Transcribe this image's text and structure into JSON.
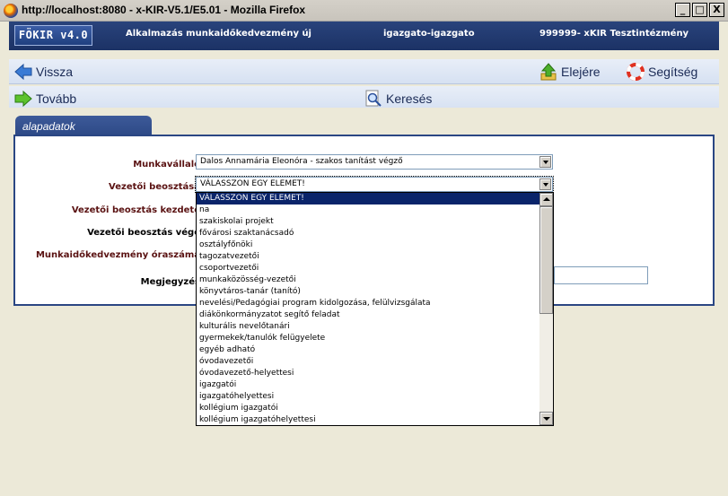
{
  "window": {
    "title": "http://localhost:8080 - x-KIR-V5.1/E5.01 - Mozilla Firefox",
    "buttons": {
      "minimize": "_",
      "restore": "□",
      "close": "X"
    }
  },
  "header": {
    "logo": "FÖKIR v4.0",
    "page_title": "Alkalmazás munkaidőkedvezmény új",
    "user": "igazgato-igazgato",
    "institution": "999999- xKIR Tesztintézmény"
  },
  "toolbar1": {
    "back": "Vissza",
    "home": "Elejére",
    "help": "Segítség"
  },
  "toolbar2": {
    "next": "Tovább",
    "search": "Keresés"
  },
  "tab": {
    "label": "alapadatok"
  },
  "form": {
    "employee_label": "Munkavállaló:",
    "employee_value": "Dalos Annamária Eleonóra - szakos tanítást végző",
    "position_label": "Vezetői beosztása:",
    "position_value": "VÁLASSZON EGY ELEMET!",
    "start_label": "Vezetői beosztás kezdete:",
    "end_label": "Vezetői beosztás vége:",
    "hours_label": "Munkaidőkedvezmény óraszáma:",
    "notes_label": "Megjegyzés:"
  },
  "dropdown": {
    "selected_index": 0,
    "options": [
      "VÁLASSZON EGY ELEMET!",
      "na",
      "szakiskolai projekt",
      "fővárosi szaktanácsadó",
      "osztályfőnöki",
      "tagozatvezetői",
      "csoportvezetői",
      "munkaközösség-vezetői",
      "könyvtáros-tanár (tanító)",
      "nevelési/Pedagógiai program kidolgozása, felülvizsgálata",
      "diákönkormányzatot segítő feladat",
      "kulturális nevelőtanári",
      "gyermekek/tanulók felügyelete",
      "egyéb adható",
      "óvodavezetői",
      "óvodavezető-helyettesi",
      "igazgatói",
      "igazgatóhelyettesi",
      "kollégium igazgatói",
      "kollégium igazgatóhelyettesi"
    ]
  }
}
